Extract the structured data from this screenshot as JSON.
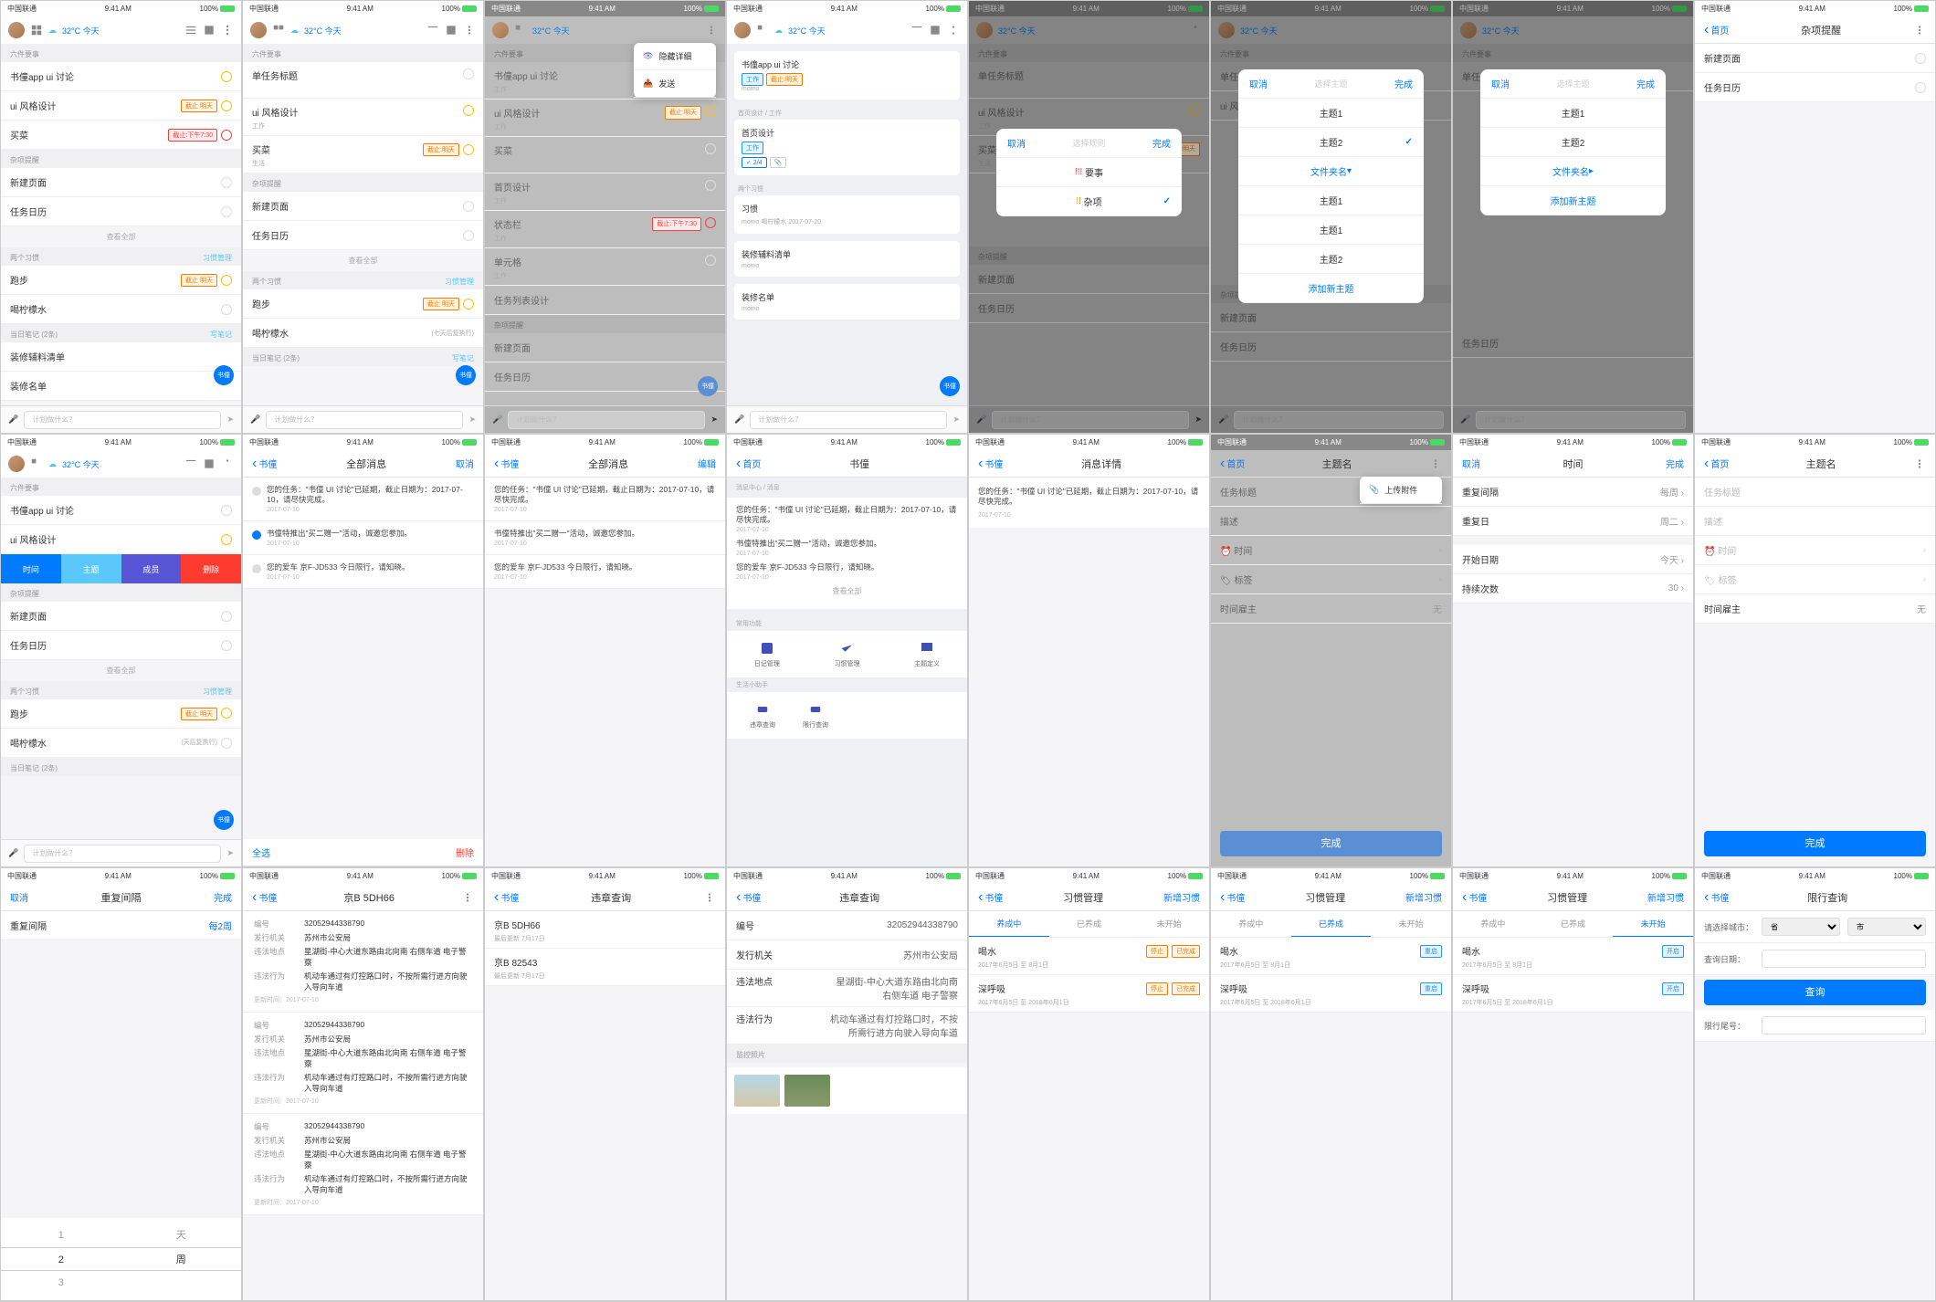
{
  "status": {
    "carrier": "中国联通",
    "wifi": "📶",
    "time": "9:41 AM",
    "battery": "100%"
  },
  "common": {
    "weather": "32°C 今天",
    "input_ph": "计划做什么？",
    "cancel": "取消",
    "done": "完成",
    "back": "首页",
    "shu": "书僮",
    "all": "查看全部",
    "edit": "编辑",
    "del": "删除",
    "selall": "全选"
  },
  "sec": {
    "six": "六件要事",
    "misc": "杂项提醒",
    "habit": "两个习惯",
    "habitm": "习惯管理",
    "diary": "当日笔记 (2条)",
    "diary2": "写笔记"
  },
  "tasks": {
    "t1": "书僮app ui 讨论",
    "t2": "ui 风格设计",
    "t3": "买菜",
    "t4": "新建页面",
    "t5": "任务日历",
    "t6": "单任务标题",
    "t7": "首页设计",
    "t8": "状态栏",
    "t9": "单元格",
    "t10": "任务列表设计",
    "t11": "习惯"
  },
  "tags": {
    "tomorrow": "截止:明天",
    "afternoon": "截止:下午7:30",
    "urgent": "截止 明天"
  },
  "habits": {
    "run": "跑步",
    "water": "喝柠檬水",
    "seven": "(七天后复执行)"
  },
  "list": {
    "l1": "装修辅料清单",
    "l2": "装修名单"
  },
  "menu": {
    "m1": "隐藏详细",
    "m2": "发送"
  },
  "modal1": {
    "title": "选择规则",
    "r1": "要事",
    "r2": "杂项"
  },
  "modal2": {
    "title": "选择主题",
    "t1": "主题1",
    "t2": "主题2",
    "fc": "文件夹名",
    "add": "添加新主题"
  },
  "misc": {
    "new": "新建页面",
    "cal": "任务日历"
  },
  "sw": {
    "time": "时间",
    "topic": "主题",
    "conv": "成员",
    "del": "删除"
  },
  "msgs": {
    "title": "全部消息",
    "m1": "您的任务：\"书僮 UI 讨论\"已延期，截止日期为：2017-07-10，请尽快完成。",
    "m2": "书僮特推出\"买二赠一\"活动，诚邀您参加。",
    "m3": "您的爱车 京F-JD533 今日限行，请知晓。",
    "date": "2017-07-10",
    "det": "消息详情"
  },
  "quick": {
    "sec1": "常用功能",
    "sec2": "生活小助手",
    "q1": "日记管理",
    "q2": "习惯管理",
    "q3": "主题定义",
    "q4": "违章查询",
    "q5": "限行查询",
    "bc": "消息中心 / 消息"
  },
  "topic": {
    "name": "主题名",
    "upload": "上传附件",
    "tt": "任务标题",
    "desc": "描述",
    "tm": "时间",
    "lb": "标签",
    "owner": "时间雇主",
    "none": "无"
  },
  "time": {
    "title": "时间",
    "rep": "重复间隔",
    "repv": "每周",
    "day": "重复日",
    "dayv": "周二",
    "start": "开始日期",
    "startv": "今天",
    "cnt": "持续次数",
    "cntv": "30"
  },
  "rep2": {
    "title": "重复间隔",
    "val": "每2周",
    "n": [
      "1",
      "2",
      "3"
    ],
    "u": [
      "天",
      "周"
    ]
  },
  "car": {
    "plate": "京B 5DH66",
    "plate2": "京B 82543",
    "sub": "最后更新 7月17日",
    "num": "编号",
    "numv": "32052944338790",
    "org": "发行机关",
    "orgv": "苏州市公安局",
    "loc": "违法地点",
    "locv": "星湖街-中心大道东路由北向南 右侧车道 电子警察",
    "act": "违法行为",
    "actv": "机动车通过有灯控路口时，不按所需行进方向驶入导向车道",
    "upd": "更新时间：2017-07-10",
    "vq": "违章查询",
    "photo": "监控照片"
  },
  "hb": {
    "title": "习惯管理",
    "new": "新增习惯",
    "t1": "养成中",
    "t2": "已养成",
    "t3": "未开始",
    "h1": "喝水",
    "h2": "深呼吸",
    "d1": "2017年6月5日 至 8月1日",
    "d2": "2017年6月5日 至 2018年6月1日",
    "stop": "停止",
    "done": "已完成",
    "open": "开启",
    "reset": "重启"
  },
  "lq": {
    "title": "限行查询",
    "city": "请选择城市：",
    "date": "查询日期：",
    "tail": "限行尾号：",
    "btn": "查询",
    "p": "省",
    "c": "市"
  }
}
